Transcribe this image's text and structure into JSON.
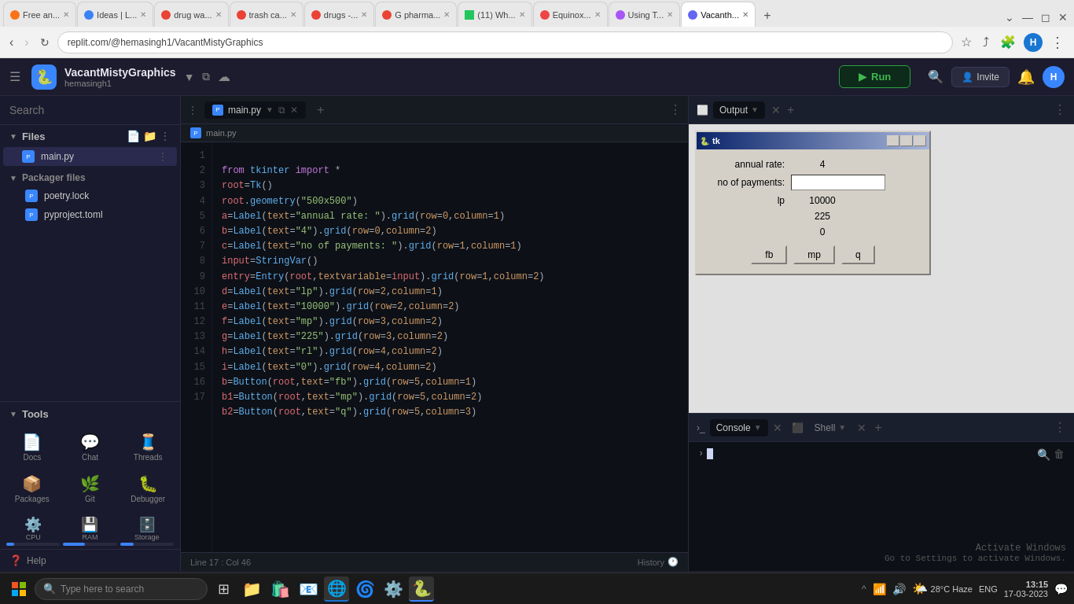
{
  "browser": {
    "tabs": [
      {
        "id": 1,
        "label": "Free an...",
        "favicon_color": "#f97316",
        "active": false
      },
      {
        "id": 2,
        "label": "Ideas | L...",
        "favicon_color": "#3b82f6",
        "active": false
      },
      {
        "id": 3,
        "label": "drug wa...",
        "favicon_color": "#ea4335",
        "active": false
      },
      {
        "id": 4,
        "label": "trash ca...",
        "favicon_color": "#ea4335",
        "active": false
      },
      {
        "id": 5,
        "label": "drugs -...",
        "favicon_color": "#ea4335",
        "active": false
      },
      {
        "id": 6,
        "label": "G pharma...",
        "favicon_color": "#ea4335",
        "active": false
      },
      {
        "id": 7,
        "label": "(11) Wh...",
        "favicon_color": "#22c55e",
        "active": false
      },
      {
        "id": 8,
        "label": "Equinox...",
        "favicon_color": "#ef4444",
        "active": false
      },
      {
        "id": 9,
        "label": "Using T...",
        "favicon_color": "#a855f7",
        "active": false
      },
      {
        "id": 10,
        "label": "Vacanth...",
        "favicon_color": "#6366f1",
        "active": true
      }
    ],
    "address": "replit.com/@hemasingh1/VacantMistyGraphics",
    "new_tab_label": "+"
  },
  "repl": {
    "name": "VacantMistyGraphics",
    "user": "hemasingh1",
    "run_label": "Run",
    "invite_label": "Invite"
  },
  "sidebar": {
    "search_placeholder": "Search",
    "files_label": "Files",
    "packager_label": "Packager files",
    "files": [
      {
        "name": "main.py",
        "active": true
      },
      {
        "name": "poetry.lock",
        "active": false
      },
      {
        "name": "pyproject.toml",
        "active": false
      }
    ],
    "tools_label": "Tools",
    "tools": [
      {
        "name": "docs",
        "label": "Docs",
        "icon": "📄"
      },
      {
        "name": "chat",
        "label": "Chat",
        "icon": "💬"
      },
      {
        "name": "threads",
        "label": "Threads",
        "icon": "🧵"
      },
      {
        "name": "packages",
        "label": "Packages",
        "icon": "📦"
      },
      {
        "name": "git",
        "label": "Git",
        "icon": "🌿"
      },
      {
        "name": "debugger",
        "label": "Debugger",
        "icon": "🐛"
      },
      {
        "name": "cpu",
        "label": "CPU",
        "icon": "⚙️"
      },
      {
        "name": "ram",
        "label": "RAM",
        "icon": "💾"
      },
      {
        "name": "storage",
        "label": "Storage",
        "icon": "🗄️"
      }
    ],
    "meters": [
      {
        "name": "CPU",
        "fill": 15,
        "color": "#3b82f6"
      },
      {
        "name": "RAM",
        "fill": 40,
        "color": "#3b82f6"
      },
      {
        "name": "Storage",
        "fill": 25,
        "color": "#3b82f6"
      }
    ],
    "help_label": "Help"
  },
  "editor": {
    "tab_label": "main.py",
    "breadcrumb": "main.py",
    "lines": [
      {
        "num": 1,
        "code": "from tkinter import *"
      },
      {
        "num": 2,
        "code": "root=Tk()"
      },
      {
        "num": 3,
        "code": "root.geometry(\"500x500\")"
      },
      {
        "num": 4,
        "code": "a=Label(text=\"annual rate: \").grid(row=0,column=1)"
      },
      {
        "num": 5,
        "code": "b=Label(text=\"4\").grid(row=0,column=2)"
      },
      {
        "num": 6,
        "code": "c=Label(text=\"no of payments: \").grid(row=1,column=1)"
      },
      {
        "num": 7,
        "code": "input=StringVar()"
      },
      {
        "num": 8,
        "code": "entry=Entry(root,textvariable=input).grid(row=1,column=2)"
      },
      {
        "num": 9,
        "code": "d=Label(text=\"lp\").grid(row=2,column=1)"
      },
      {
        "num": 10,
        "code": "e=Label(text=\"10000\").grid(row=2,column=2)"
      },
      {
        "num": 11,
        "code": "f=Label(text=\"mp\").grid(row=3,column=2)"
      },
      {
        "num": 12,
        "code": "g=Label(text=\"225\").grid(row=3,column=2)"
      },
      {
        "num": 13,
        "code": "h=Label(text=\"rl\").grid(row=4,column=2)"
      },
      {
        "num": 14,
        "code": "i=Label(text=\"0\").grid(row=4,column=2)"
      },
      {
        "num": 15,
        "code": "b=Button(root,text=\"fb\").grid(row=5,column=1)"
      },
      {
        "num": 16,
        "code": "b1=Button(root,text=\"mp\").grid(row=5,column=2)"
      },
      {
        "num": 17,
        "code": "b2=Button(root,text=\"q\").grid(row=5,column=3)"
      }
    ],
    "status_line": "Line 17 : Col 46",
    "history_label": "History"
  },
  "output": {
    "panel_label": "Output",
    "tk_title": "tk",
    "fields": [
      {
        "label": "annual rate:",
        "value": "4",
        "type": "label"
      },
      {
        "label": "no of payments:",
        "value": "",
        "type": "entry"
      },
      {
        "label": "lp",
        "value": "10000",
        "type": "label"
      },
      {
        "label": "",
        "value": "225",
        "type": "label"
      },
      {
        "label": "",
        "value": "0",
        "type": "label"
      }
    ],
    "buttons": [
      "fb",
      "mp",
      "q"
    ]
  },
  "console": {
    "panel_label": "Console",
    "shell_label": "Shell",
    "watermark_title": "Activate Windows",
    "watermark_sub": "Go to Settings to activate Windows."
  },
  "taskbar": {
    "search_placeholder": "Type here to search",
    "time": "13:15",
    "date": "17-03-2023",
    "weather": "28°C  Haze",
    "language": "ENG"
  }
}
